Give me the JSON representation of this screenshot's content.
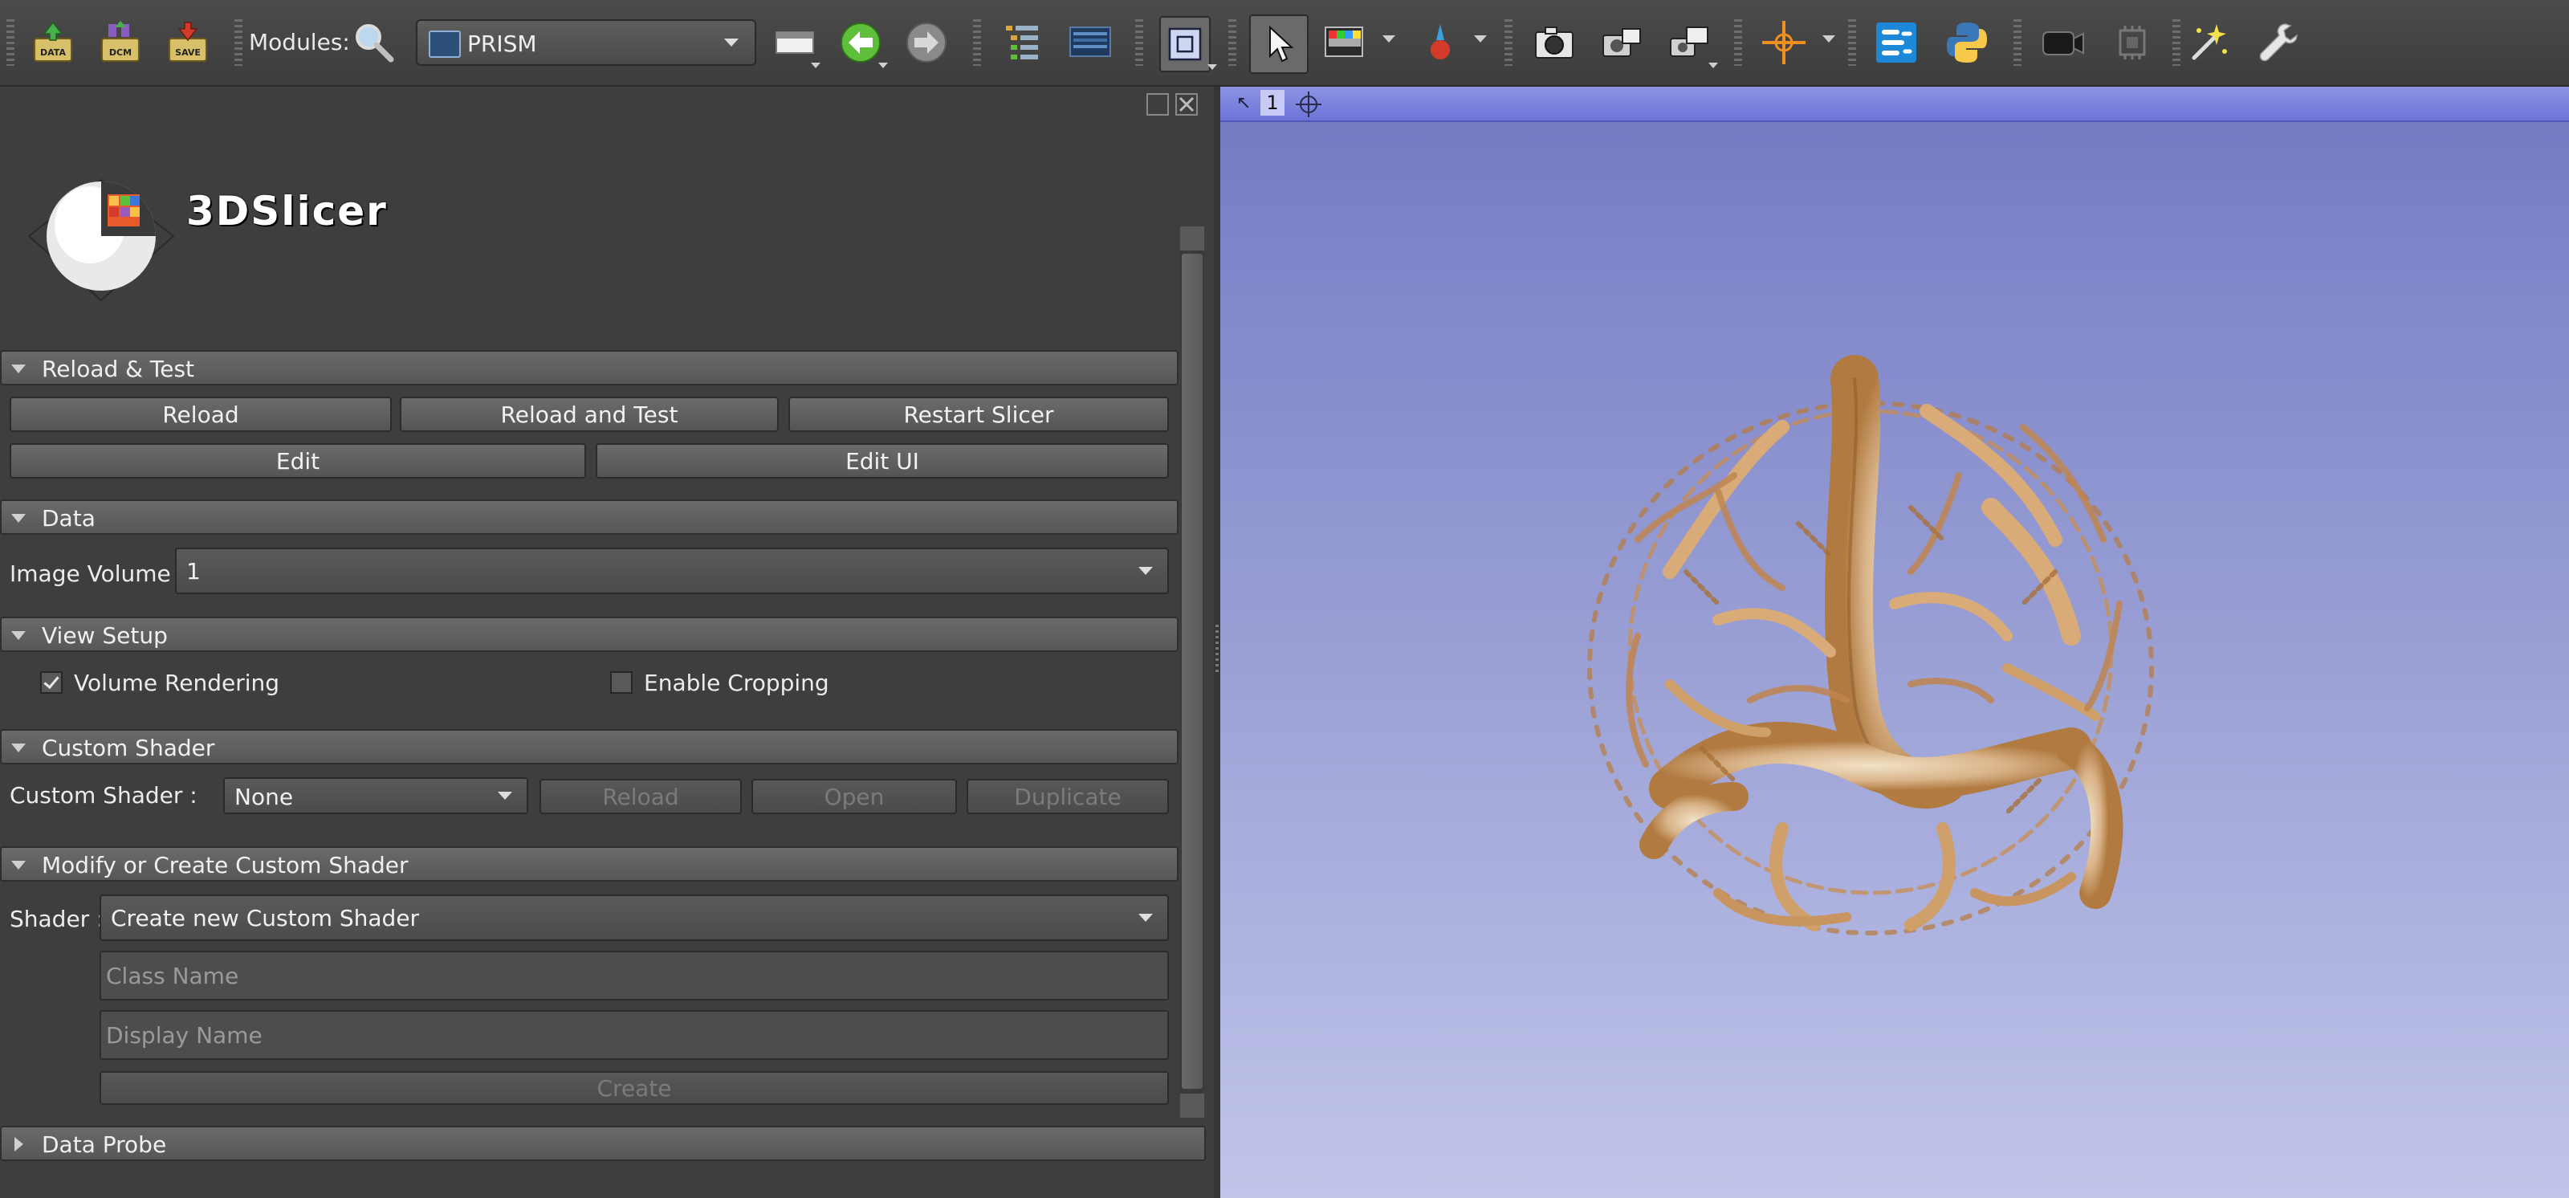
{
  "toolbar": {
    "data_button": "DATA",
    "dcm_button": "DCM",
    "save_button": "SAVE",
    "modules_label": "Modules:",
    "module_selected": "PRISM"
  },
  "logo": {
    "text": "3DSlicer"
  },
  "reload_test": {
    "header": "Reload & Test",
    "reload": "Reload",
    "reload_and_test": "Reload and Test",
    "restart": "Restart Slicer",
    "edit": "Edit",
    "edit_ui": "Edit UI"
  },
  "data_section": {
    "header": "Data",
    "image_volume_label": "Image Volume :",
    "image_volume_value": "1"
  },
  "view_setup": {
    "header": "View Setup",
    "volume_rendering": "Volume Rendering",
    "volume_rendering_checked": true,
    "enable_cropping": "Enable Cropping",
    "enable_cropping_checked": false
  },
  "custom_shader": {
    "header": "Custom Shader",
    "label": "Custom Shader :",
    "value": "None",
    "reload": "Reload",
    "open": "Open",
    "duplicate": "Duplicate"
  },
  "modify_shader": {
    "header": "Modify or Create Custom Shader",
    "shader_label": "Shader :",
    "shader_value": "Create new Custom Shader",
    "class_name_placeholder": "Class Name",
    "display_name_placeholder": "Display Name",
    "create": "Create"
  },
  "data_probe": {
    "header": "Data Probe"
  },
  "view": {
    "number": "1",
    "background_top": "#7379c3",
    "background_bottom": "#c1c5ea"
  }
}
